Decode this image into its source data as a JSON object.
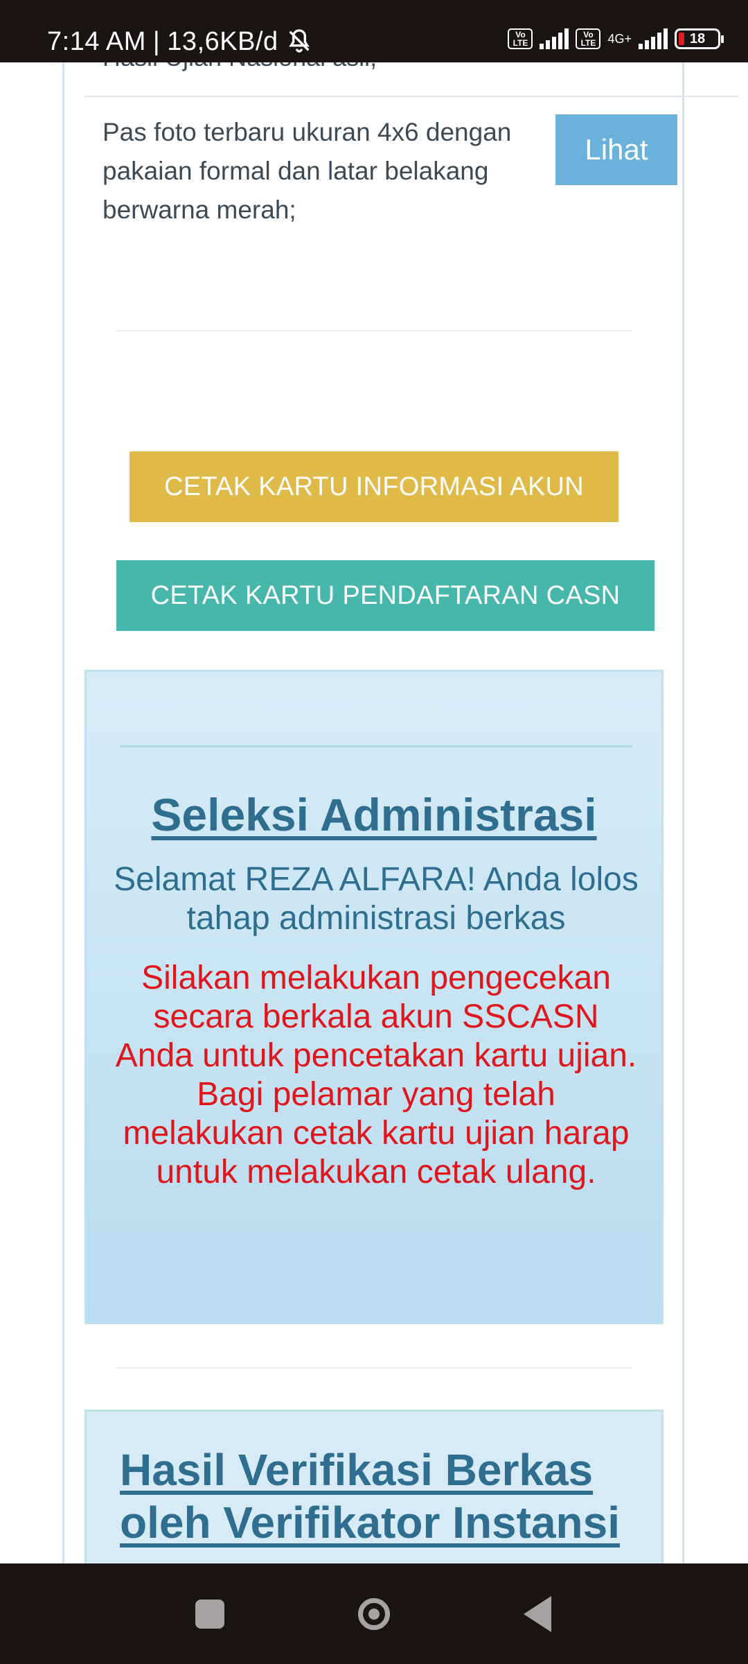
{
  "status_bar": {
    "time": "7:14 AM",
    "separator": "|",
    "network_speed": "13,6KB/d",
    "network_type": "4G+",
    "battery_level": "18",
    "icons": [
      "bell-off-icon",
      "volte-icon",
      "signal-icon",
      "battery-icon"
    ]
  },
  "document_list": {
    "prev_item_partial": "Hasil Ujian Nasional asli;",
    "item_text": "Pas foto terbaru ukuran 4x6 dengan pakaian formal dan latar belakang berwarna merah;",
    "view_button": "Lihat"
  },
  "actions": {
    "print_account_card": "CETAK KARTU INFORMASI AKUN",
    "print_registration_card": "CETAK KARTU PENDAFTARAN CASN"
  },
  "admin_selection": {
    "title": "Seleksi Administrasi",
    "congrats": "Selamat REZA ALFARA! Anda lolos tahap administrasi berkas",
    "notice": "Silakan melakukan pengecekan secara berkala akun SSCASN Anda untuk pencetakan kartu ujian. Bagi pelamar yang telah melakukan cetak kartu ujian harap untuk melakukan cetak ulang."
  },
  "verification": {
    "title": "Hasil Verifikasi Berkas oleh Verifikator Instansi"
  },
  "colors": {
    "status_bar_bg": "#1b1412",
    "view_button": "#68b2dc",
    "print_account_button": "#e0ba48",
    "print_registration_button": "#47b7ab",
    "panel_title": "#2f6e8f",
    "notice_text": "#e0161c"
  }
}
